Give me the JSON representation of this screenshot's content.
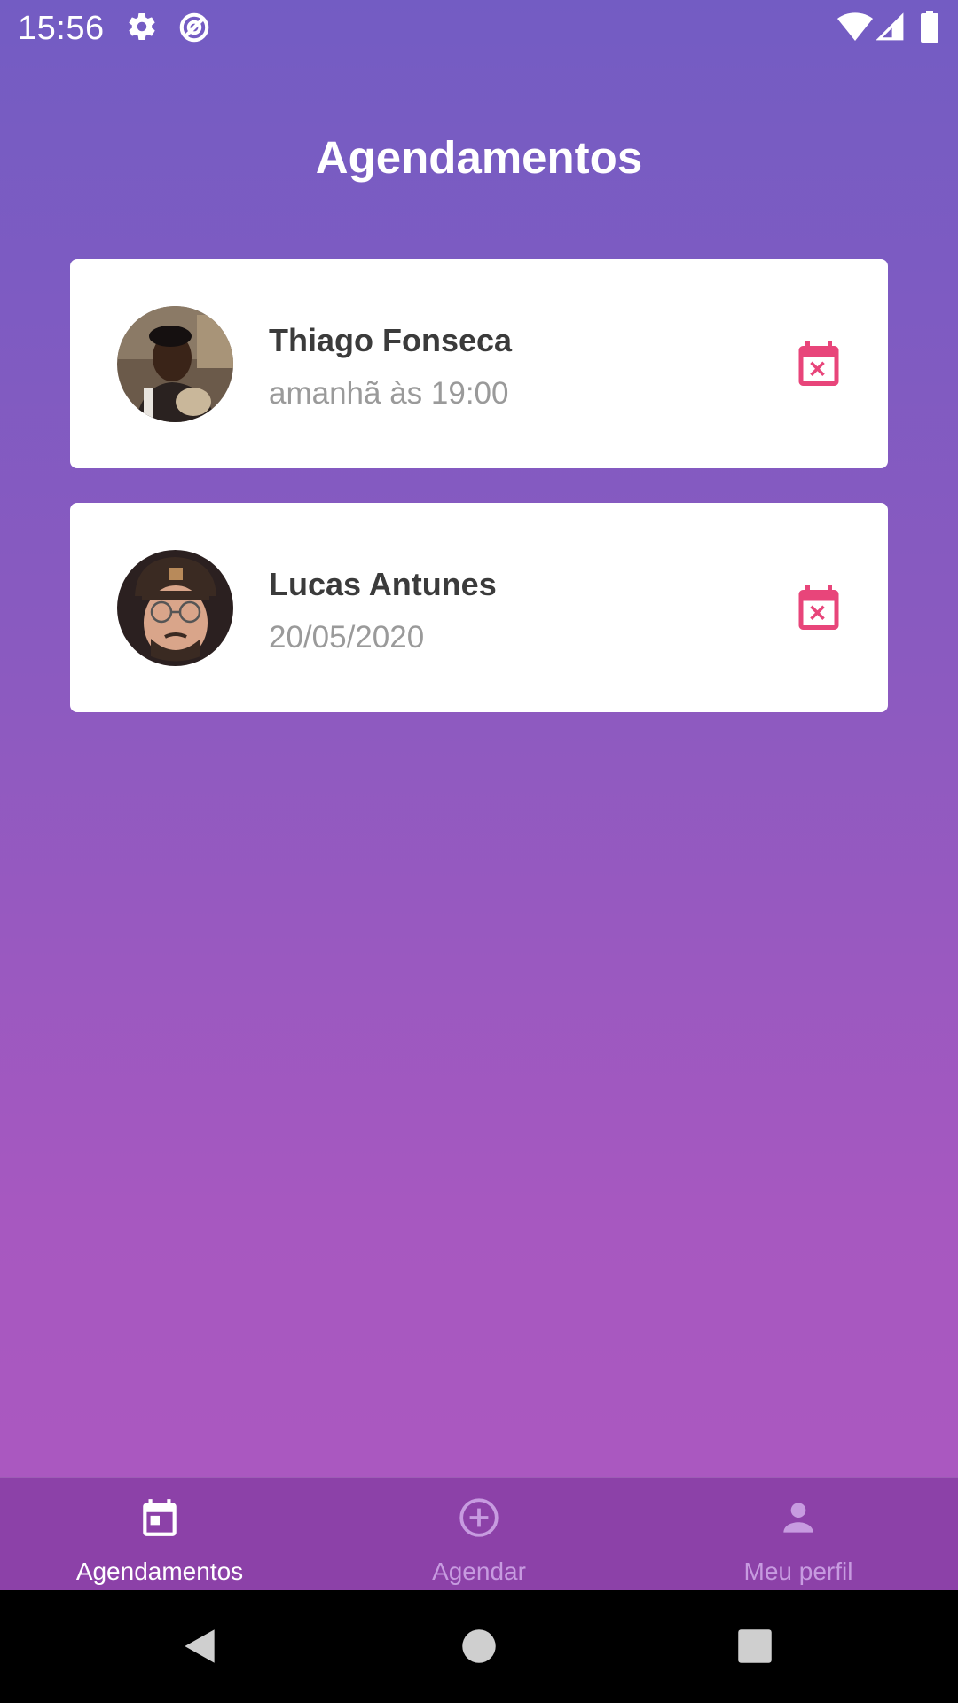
{
  "status_bar": {
    "time": "15:56",
    "icons": [
      "gear-icon",
      "do-not-disturb-icon",
      "wifi-icon",
      "signal-icon",
      "battery-icon"
    ]
  },
  "page": {
    "title": "Agendamentos"
  },
  "appointments": [
    {
      "name": "Thiago Fonseca",
      "date": "amanhã às 19:00",
      "avatar": "avatar-photo",
      "action_icon": "calendar-cancel-icon"
    },
    {
      "name": "Lucas Antunes",
      "date": "20/05/2020",
      "avatar": "avatar-photo",
      "action_icon": "calendar-cancel-icon"
    }
  ],
  "bottom_nav": {
    "items": [
      {
        "label": "Agendamentos",
        "icon": "calendar-icon",
        "active": true
      },
      {
        "label": "Agendar",
        "icon": "add-circle-icon",
        "active": false
      },
      {
        "label": "Meu perfil",
        "icon": "person-icon",
        "active": false
      }
    ]
  },
  "colors": {
    "background_top": "#735cc3",
    "background_bottom": "#ad58c0",
    "accent_cancel": "#e8457a",
    "nav_background": "#8c41a8",
    "nav_inactive": "#c79be0",
    "name_text": "#3b3b3b",
    "date_text": "#9a9a9a"
  }
}
